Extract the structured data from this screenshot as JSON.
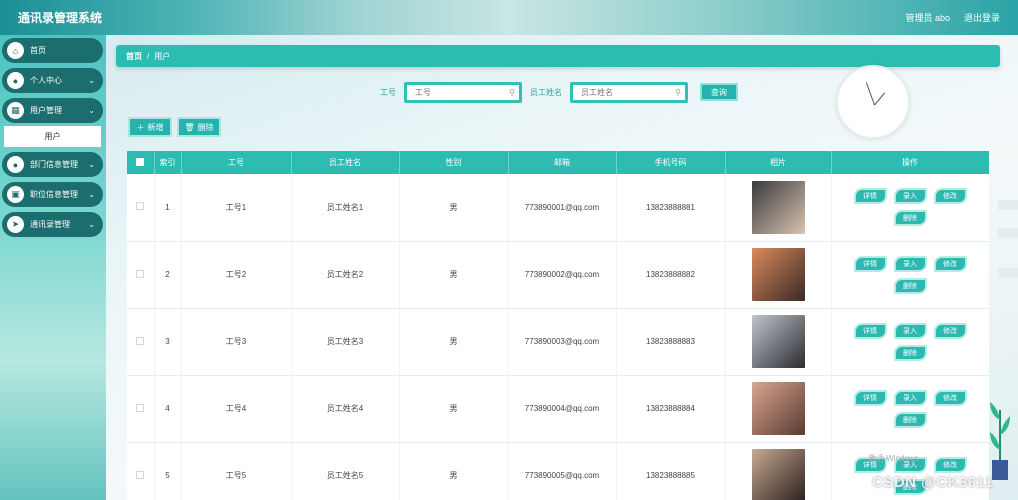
{
  "app": {
    "title": "通讯录管理系统"
  },
  "header": {
    "user_label": "管理员 abo",
    "logout_label": "退出登录"
  },
  "sidebar": {
    "items": [
      {
        "label": "首页",
        "icon": "home-icon",
        "glyph": "⌂",
        "has_chevron": false
      },
      {
        "label": "个人中心",
        "icon": "person-icon",
        "glyph": "●",
        "has_chevron": true
      },
      {
        "label": "用户管理",
        "icon": "grid-icon",
        "glyph": "▦",
        "has_chevron": true
      },
      {
        "label": "部门信息管理",
        "icon": "person-icon",
        "glyph": "●",
        "has_chevron": true
      },
      {
        "label": "职位信息管理",
        "icon": "briefcase-icon",
        "glyph": "▣",
        "has_chevron": true
      },
      {
        "label": "通讯录管理",
        "icon": "send-icon",
        "glyph": "➤",
        "has_chevron": true
      }
    ],
    "sub_item": "用户"
  },
  "breadcrumb": {
    "home": "首页",
    "separator": "/",
    "current": "用户"
  },
  "search": {
    "field1_label": "工号",
    "field1_placeholder": "工号",
    "field2_label": "员工姓名",
    "field2_placeholder": "员工姓名",
    "query_label": "查询"
  },
  "actions": {
    "add_label": "新增",
    "delete_label": "删除"
  },
  "table": {
    "columns": [
      "",
      "索引",
      "工号",
      "员工姓名",
      "性别",
      "邮箱",
      "手机号码",
      "相片",
      "操作"
    ],
    "rows": [
      {
        "index": "1",
        "id": "工号1",
        "name": "员工姓名1",
        "gender": "男",
        "email": "773890001@qq.com",
        "phone": "13823888881",
        "photo_colors": [
          "#3a3a40",
          "#d8c4b0"
        ]
      },
      {
        "index": "2",
        "id": "工号2",
        "name": "员工姓名2",
        "gender": "男",
        "email": "773890002@qq.com",
        "phone": "13823888882",
        "photo_colors": [
          "#d98a5a",
          "#3a2a26"
        ]
      },
      {
        "index": "3",
        "id": "工号3",
        "name": "员工姓名3",
        "gender": "男",
        "email": "773890003@qq.com",
        "phone": "13823888883",
        "photo_colors": [
          "#bfc6cc",
          "#2b2b30"
        ]
      },
      {
        "index": "4",
        "id": "工号4",
        "name": "员工姓名4",
        "gender": "男",
        "email": "773890004@qq.com",
        "phone": "13823888884",
        "photo_colors": [
          "#d7a690",
          "#5a3a30"
        ]
      },
      {
        "index": "5",
        "id": "工号5",
        "name": "员工姓名5",
        "gender": "男",
        "email": "773890005@qq.com",
        "phone": "13823888885",
        "photo_colors": [
          "#c9aa90",
          "#2a2020"
        ]
      }
    ],
    "row_buttons": {
      "detail": "详情",
      "enter": "录入",
      "edit": "修改",
      "delete": "删除"
    }
  },
  "overlay": {
    "windows_text": "激活 Windows",
    "csdn_text": "CSDN @CK3011"
  },
  "colors": {
    "accent": "#2cbcb1",
    "nav_bg": "#1b6d6e"
  }
}
